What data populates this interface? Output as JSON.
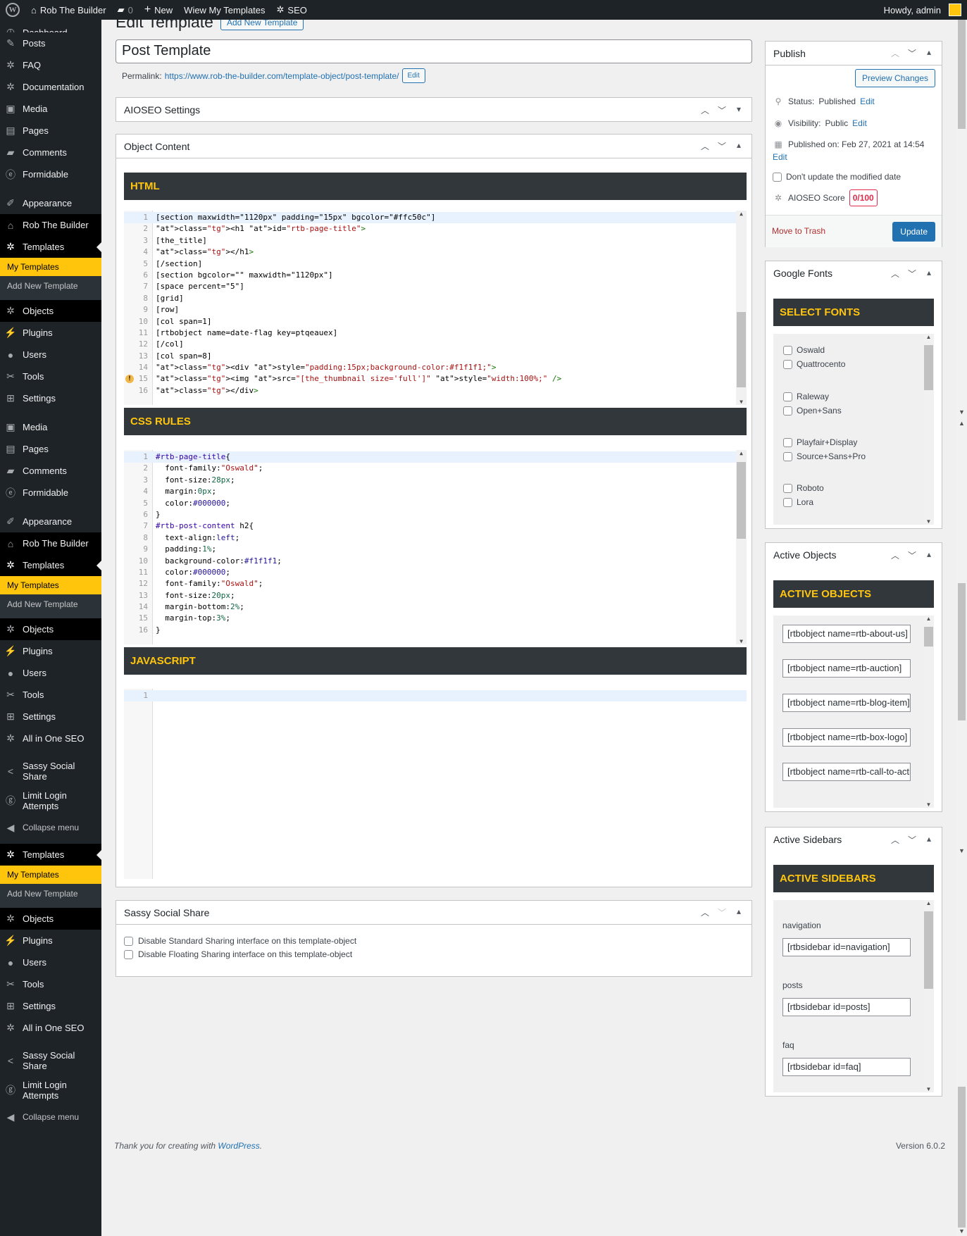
{
  "admin_bar": {
    "site": "Rob The Builder",
    "comments": "0",
    "new": "New",
    "view": "Wiew My Templates",
    "seo": "SEO",
    "howdy": "Howdy, admin"
  },
  "menu": [
    {
      "label": "Dashboard",
      "icon": "dashboard-icon",
      "glyph": "◷",
      "h": 18,
      "type": "partial"
    },
    {
      "label": "Posts",
      "icon": "pin-icon",
      "glyph": "✎",
      "h": 31
    },
    {
      "label": "FAQ",
      "icon": "gear-icon",
      "glyph": "✲",
      "h": 31
    },
    {
      "label": "Documentation",
      "icon": "gear-icon",
      "glyph": "✲",
      "h": 31
    },
    {
      "label": "Media",
      "icon": "media-icon",
      "glyph": "▣",
      "h": 31
    },
    {
      "label": "Pages",
      "icon": "page-icon",
      "glyph": "▤",
      "h": 31
    },
    {
      "label": "Comments",
      "icon": "comment-icon",
      "glyph": "▰",
      "h": 31
    },
    {
      "label": "Formidable",
      "icon": "formidable-icon",
      "glyph": "ⓔ",
      "h": 31
    },
    {
      "label": "",
      "type": "gap",
      "h": 10
    },
    {
      "label": "Appearance",
      "icon": "brush-icon",
      "glyph": "✐",
      "h": 31
    },
    {
      "label": "Rob The Builder",
      "icon": "home-icon",
      "glyph": "⌂",
      "h": 31,
      "dark": true
    },
    {
      "label": "Templates",
      "icon": "gear-icon",
      "glyph": "✲",
      "h": 31,
      "cur": true
    },
    {
      "type": "sub",
      "items": [
        "My Templates",
        "Add New Template"
      ]
    },
    {
      "label": "Objects",
      "icon": "gear-icon",
      "glyph": "✲",
      "h": 31,
      "dark": true
    },
    {
      "label": "Plugins",
      "icon": "plugin-icon",
      "glyph": "⚡",
      "h": 31
    },
    {
      "label": "Users",
      "icon": "user-icon",
      "glyph": "●",
      "h": 31
    },
    {
      "label": "Tools",
      "icon": "wrench-icon",
      "glyph": "✂",
      "h": 31
    },
    {
      "label": "Settings",
      "icon": "settings-icon",
      "glyph": "⊞",
      "h": 31
    },
    {
      "label": "",
      "type": "gap",
      "h": 10
    },
    {
      "label": "Media",
      "icon": "media-icon",
      "glyph": "▣",
      "h": 31
    },
    {
      "label": "Pages",
      "icon": "page-icon",
      "glyph": "▤",
      "h": 31
    },
    {
      "label": "Comments",
      "icon": "comment-icon",
      "glyph": "▰",
      "h": 31
    },
    {
      "label": "Formidable",
      "icon": "formidable-icon",
      "glyph": "ⓔ",
      "h": 31
    },
    {
      "label": "",
      "type": "gap",
      "h": 10
    },
    {
      "label": "Appearance",
      "icon": "brush-icon",
      "glyph": "✐",
      "h": 31
    },
    {
      "label": "Rob The Builder",
      "icon": "home-icon",
      "glyph": "⌂",
      "h": 31,
      "dark": true
    },
    {
      "label": "Templates",
      "icon": "gear-icon",
      "glyph": "✲",
      "h": 31,
      "cur": true
    },
    {
      "type": "sub",
      "items": [
        "My Templates",
        "Add New Template"
      ]
    },
    {
      "label": "Objects",
      "icon": "gear-icon",
      "glyph": "✲",
      "h": 31,
      "dark": true
    },
    {
      "label": "Plugins",
      "icon": "plugin-icon",
      "glyph": "⚡",
      "h": 31
    },
    {
      "label": "Users",
      "icon": "user-icon",
      "glyph": "●",
      "h": 31
    },
    {
      "label": "Tools",
      "icon": "wrench-icon",
      "glyph": "✂",
      "h": 31
    },
    {
      "label": "Settings",
      "icon": "settings-icon",
      "glyph": "⊞",
      "h": 31
    },
    {
      "label": "All in One SEO",
      "icon": "aioseo-icon",
      "glyph": "✲",
      "h": 31
    },
    {
      "label": "",
      "type": "gap",
      "h": 10
    },
    {
      "label": "Sassy Social Share",
      "icon": "share-icon",
      "glyph": "<",
      "h": 42
    },
    {
      "label": "Limit Login Attempts",
      "icon": "limit-login-icon",
      "glyph": "ⓖ",
      "h": 42
    },
    {
      "label": "Collapse menu",
      "icon": "collapse-icon",
      "glyph": "◀",
      "h": 34,
      "small": true
    },
    {
      "label": "",
      "type": "gap",
      "h": 6
    },
    {
      "label": "Templates",
      "icon": "gear-icon",
      "glyph": "✲",
      "h": 31,
      "cur": true
    },
    {
      "type": "sub",
      "items": [
        "My Templates",
        "Add New Template"
      ]
    },
    {
      "label": "Objects",
      "icon": "gear-icon",
      "glyph": "✲",
      "h": 31,
      "dark": true
    },
    {
      "label": "Plugins",
      "icon": "plugin-icon",
      "glyph": "⚡",
      "h": 31
    },
    {
      "label": "Users",
      "icon": "user-icon",
      "glyph": "●",
      "h": 31
    },
    {
      "label": "Tools",
      "icon": "wrench-icon",
      "glyph": "✂",
      "h": 31
    },
    {
      "label": "Settings",
      "icon": "settings-icon",
      "glyph": "⊞",
      "h": 31
    },
    {
      "label": "All in One SEO",
      "icon": "aioseo-icon",
      "glyph": "✲",
      "h": 31
    },
    {
      "label": "",
      "type": "gap",
      "h": 10
    },
    {
      "label": "Sassy Social Share",
      "icon": "share-icon",
      "glyph": "<",
      "h": 42
    },
    {
      "label": "Limit Login Attempts",
      "icon": "limit-login-icon",
      "glyph": "ⓖ",
      "h": 42
    },
    {
      "label": "Collapse menu",
      "icon": "collapse-icon",
      "glyph": "◀",
      "h": 34,
      "small": true
    }
  ],
  "page": {
    "heading": "Edit Template",
    "add_new": "Add New Template",
    "title_value": "Post Template",
    "permalink_label": "Permalink:",
    "permalink_url": "https://www.rob-the-builder.com/template-object/post-template/",
    "permalink_edit": "Edit"
  },
  "aioseo_box": {
    "title": "AIOSEO Settings"
  },
  "object_box": {
    "title": "Object Content",
    "html_heading": "HTML",
    "css_heading": "CSS RULES",
    "js_heading": "JAVASCRIPT"
  },
  "html_code": [
    "[section maxwidth=\"1120px\" padding=\"15px\" bgcolor=\"#ffc50c\"]",
    "<h1 id=\"rtb-page-title\">",
    "[the_title]",
    "</h1>",
    "[/section]",
    "[section bgcolor=\"\" maxwidth=\"1120px\"]",
    "[space percent=\"5\"]",
    "[grid]",
    "[row]",
    "[col span=1]",
    "[rtbobject name=date-flag key=ptqeauex]",
    "[/col]",
    "[col span=8]",
    "<div style=\"padding:15px;background-color:#f1f1f1;\">",
    "<img src=\"[the_thumbnail size='full']\" style=\"width:100%;\" />",
    "</div>"
  ],
  "css_code": [
    "#rtb-page-title{",
    "  font-family:\"Oswald\";",
    "  font-size:28px;",
    "  margin:0px;",
    "  color:#000000;",
    "}",
    "#rtb-post-content h2{",
    "  text-align:left;",
    "  padding:1%;",
    "  background-color:#f1f1f1;",
    "  color:#000000;",
    "  font-family:\"Oswald\";",
    "  font-size:20px;",
    "  margin-bottom:2%;",
    "  margin-top:3%;",
    "}"
  ],
  "js_code": [
    ""
  ],
  "sassy_box": {
    "title": "Sassy Social Share",
    "opt1": "Disable Standard Sharing interface on this template-object",
    "opt2": "Disable Floating Sharing interface on this template-object"
  },
  "publish": {
    "title": "Publish",
    "preview": "Preview Changes",
    "status_label": "Status:",
    "status_value": "Published",
    "status_edit": "Edit",
    "visibility_label": "Visibility:",
    "visibility_value": "Public",
    "visibility_edit": "Edit",
    "published_on": "Published on: Feb 27, 2021 at 14:54",
    "published_edit": "Edit",
    "no_update_date": "Don't update the modified date",
    "aioseo_score_label": "AIOSEO Score",
    "aioseo_score": "0/100",
    "trash": "Move to Trash",
    "update": "Update"
  },
  "google_fonts": {
    "title": "Google Fonts",
    "heading": "SELECT FONTS",
    "fonts": [
      "Oswald",
      "Quattrocento",
      "Raleway",
      "Open+Sans",
      "Playfair+Display",
      "Source+Sans+Pro",
      "Roboto",
      "Lora"
    ]
  },
  "active_objects": {
    "title": "Active Objects",
    "heading": "ACTIVE OBJECTS",
    "items": [
      "[rtbobject name=rtb-about-us]",
      "[rtbobject name=rtb-auction]",
      "[rtbobject name=rtb-blog-item]",
      "[rtbobject name=rtb-box-logo]",
      "[rtbobject name=rtb-call-to-action]"
    ]
  },
  "active_sidebars": {
    "title": "Active Sidebars",
    "heading": "ACTIVE SIDEBARS",
    "items": [
      {
        "name": "navigation",
        "code": "[rtbsidebar id=navigation]"
      },
      {
        "name": "posts",
        "code": "[rtbsidebar id=posts]"
      },
      {
        "name": "faq",
        "code": "[rtbsidebar id=faq]"
      }
    ]
  },
  "footer": {
    "thanks": "Thank you for creating with ",
    "wp": "WordPress",
    "dot": ".",
    "version": "Version 6.0.2"
  },
  "colors": {
    "accent": "#ffc50c",
    "dark": "#1d2327",
    "section": "#32373c",
    "primary": "#2271b1"
  }
}
